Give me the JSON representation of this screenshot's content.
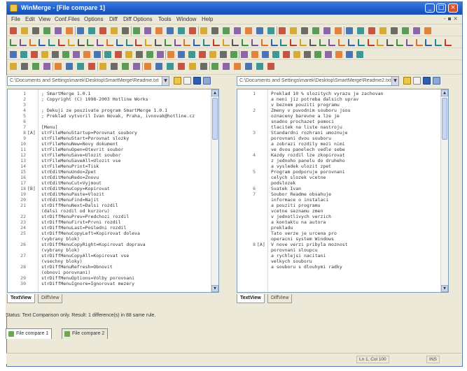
{
  "window": {
    "title": "WinMerge - [File compare 1]",
    "controls": [
      "_",
      "□",
      "×"
    ]
  },
  "menu": {
    "items": [
      "File",
      "Edit",
      "View",
      "Conf.Files",
      "Options",
      "Diff",
      "Diff Options",
      "Tools",
      "Window",
      "Help"
    ],
    "mdi_controls": "- ▪ ×"
  },
  "left": {
    "path": "C:\\Documents and Settings\\marek\\Desktop\\SmartMerge\\Readme.txt",
    "tabs": [
      "TextView",
      "DiffView"
    ],
    "lines": [
      {
        "num": "1",
        "mark": "",
        "text": "; SmartMerge 1.0.1"
      },
      {
        "num": "2",
        "mark": "",
        "text": "; Copyright (C) 1998-2003 Hotline Works"
      },
      {
        "num": "3",
        "mark": "",
        "text": ""
      },
      {
        "num": "4",
        "mark": "",
        "text": "; Dekuji ze pouzivate program SmartMerge 1.0.1"
      },
      {
        "num": "5",
        "mark": "",
        "text": "; Preklad vytvoril Ivan Novak, Praha, ivnovak@hotline.cz"
      },
      {
        "num": "6",
        "mark": "",
        "text": ""
      },
      {
        "num": "7",
        "mark": "",
        "text": "[Menu]"
      },
      {
        "num": "8",
        "mark": "[A]",
        "text": "strFileMenuStartup=Porovnat soubory"
      },
      {
        "num": "9",
        "mark": "",
        "text": "strFileMenuStart=Porovnat slozky"
      },
      {
        "num": "10",
        "mark": "",
        "text": "strFileMenuNew=Novy dokument"
      },
      {
        "num": "11",
        "mark": "",
        "text": "strFileMenuOpen=Otevrit soubor"
      },
      {
        "num": "12",
        "mark": "",
        "text": "strFileMenuSave=Ulozit soubor"
      },
      {
        "num": "13",
        "mark": "",
        "text": "strFileMenuSaveAll=Ulozit vse"
      },
      {
        "num": "14",
        "mark": "",
        "text": "strFileMenuPrint=Tisk"
      },
      {
        "num": "15",
        "mark": "",
        "text": "strEditMenuUndo=Zpet"
      },
      {
        "num": "16",
        "mark": "",
        "text": "strEditMenuRedo=Znovu"
      },
      {
        "num": "17",
        "mark": "",
        "text": "strEditMenuCut=Vyjmout"
      },
      {
        "num": "18",
        "mark": "[B]",
        "text": "strEditMenuCopy=Kopirovat"
      },
      {
        "num": "19",
        "mark": "",
        "text": "strEditMenuPaste=Vlozit"
      },
      {
        "num": "20",
        "mark": "",
        "text": "strEditMenuFind=Najit"
      },
      {
        "num": "21",
        "mark": "",
        "text": "strDiffMenuNext=Dalsi rozdil"
      },
      {
        "num": "",
        "mark": "",
        "text": "      (dalsi rozdil od kurzoru)"
      },
      {
        "num": "22",
        "mark": "",
        "text": "strDiffMenuPrev=Predchozi rozdil"
      },
      {
        "num": "23",
        "mark": "",
        "text": "strDiffMenuFirst=Prvni rozdil"
      },
      {
        "num": "24",
        "mark": "",
        "text": "strDiffMenuLast=Posledni rozdil"
      },
      {
        "num": "25",
        "mark": "",
        "text": "strDiffMenuCopyLeft=Kopirovat doleva"
      },
      {
        "num": "",
        "mark": "",
        "text": "      (vybrany blok)"
      },
      {
        "num": "26",
        "mark": "",
        "text": "strDiffMenuCopyRight=Kopirovat doprava"
      },
      {
        "num": "",
        "mark": "",
        "text": "      (vybrany blok)"
      },
      {
        "num": "27",
        "mark": "",
        "text": "strDiffMenuCopyAll=Kopirovat vse"
      },
      {
        "num": "",
        "mark": "",
        "text": "      (vsechny bloky)"
      },
      {
        "num": "28",
        "mark": "",
        "text": "strDiffMenuRefresh=Obnovit"
      },
      {
        "num": "",
        "mark": "",
        "text": "      (obnovi porovnani)"
      },
      {
        "num": "29",
        "mark": "",
        "text": "strDiffMenuOptions=Volby porovnani"
      },
      {
        "num": "30",
        "mark": "",
        "text": "strDiffMenuIgnore=Ignorovat mezery"
      }
    ]
  },
  "right": {
    "path": "C:\\Documents and Settings\\marek\\Desktop\\SmartMerge\\Readme2.txt",
    "tabs": [
      "TextView",
      "DiffView"
    ],
    "lines": [
      {
        "num": "1",
        "mark": "",
        "text": "Preklad 10 % slozitych vyrazu je zachovan"
      },
      {
        "num": "",
        "mark": "",
        "text": "a neni jiz potreba dalsich uprav"
      },
      {
        "num": "",
        "mark": "",
        "text": "v beznem pouziti programu"
      },
      {
        "num": "2",
        "mark": "",
        "text": "Zmeny v puvodnim souboru jsou"
      },
      {
        "num": "",
        "mark": "",
        "text": "oznaceny barevne a lze je"
      },
      {
        "num": "",
        "mark": "",
        "text": "snadno prochazet pomoci"
      },
      {
        "num": "",
        "mark": "",
        "text": "tlacitek na liste nastroju"
      },
      {
        "num": "3",
        "mark": "",
        "text": "Standardni rozhrani umoznuje"
      },
      {
        "num": "",
        "mark": "",
        "text": "porovnani dvou souboru"
      },
      {
        "num": "",
        "mark": "",
        "text": "a zobrazi rozdily mezi nimi"
      },
      {
        "num": "",
        "mark": "",
        "text": "ve dvou panelech vedle sebe"
      },
      {
        "num": "4",
        "mark": "",
        "text": "Kazdy rozdil lze zkopirovat"
      },
      {
        "num": "",
        "mark": "",
        "text": "z jednoho panelu do druheho"
      },
      {
        "num": "",
        "mark": "",
        "text": "a vysledek ulozit zpet"
      },
      {
        "num": "5",
        "mark": "",
        "text": "Program podporuje porovnani"
      },
      {
        "num": "",
        "mark": "",
        "text": "celych slozek vcetne"
      },
      {
        "num": "",
        "mark": "",
        "text": "podslozek"
      },
      {
        "num": "6",
        "mark": "",
        "text": "Svatek Ivan"
      },
      {
        "num": "7",
        "mark": "",
        "text": "Soubor Readme obsahuje"
      },
      {
        "num": "",
        "mark": "",
        "text": "informace o instalaci"
      },
      {
        "num": "",
        "mark": "",
        "text": "a pouziti programu"
      },
      {
        "num": "",
        "mark": "",
        "text": "vcetne seznamu zmen"
      },
      {
        "num": "",
        "mark": "",
        "text": "v jednotlivych verzich"
      },
      {
        "num": "",
        "mark": "",
        "text": "a kontaktu na autora"
      },
      {
        "num": "",
        "mark": "",
        "text": "prekladu"
      },
      {
        "num": "",
        "mark": "",
        "text": "Tato verze je urcena pro"
      },
      {
        "num": "",
        "mark": "",
        "text": "operacni system Windows"
      },
      {
        "num": "8",
        "mark": "[A]",
        "text": "V nove verzi pribyla moznost"
      },
      {
        "num": "",
        "mark": "",
        "text": "porovnani sloupcu"
      },
      {
        "num": "",
        "mark": "",
        "text": "a rychlejsi nacitani"
      },
      {
        "num": "",
        "mark": "",
        "text": "velkych souboru"
      },
      {
        "num": "",
        "mark": "",
        "text": "a souboru s dlouhymi radky"
      }
    ]
  },
  "status": {
    "text": "Status: Text Comparison only. Result: 1 difference(s) in 88 same rule."
  },
  "doc_tabs": [
    "File compare 1",
    "File compare 2"
  ],
  "statusbar": {
    "position": "Ln 1, Col 100",
    "mode": "INS"
  },
  "colors": {
    "title_bar": "#1e5cc8",
    "toolbar_red": "#c0392b",
    "toolbar_green": "#3e8e3e",
    "toolbar_blue": "#2f5fb0"
  }
}
